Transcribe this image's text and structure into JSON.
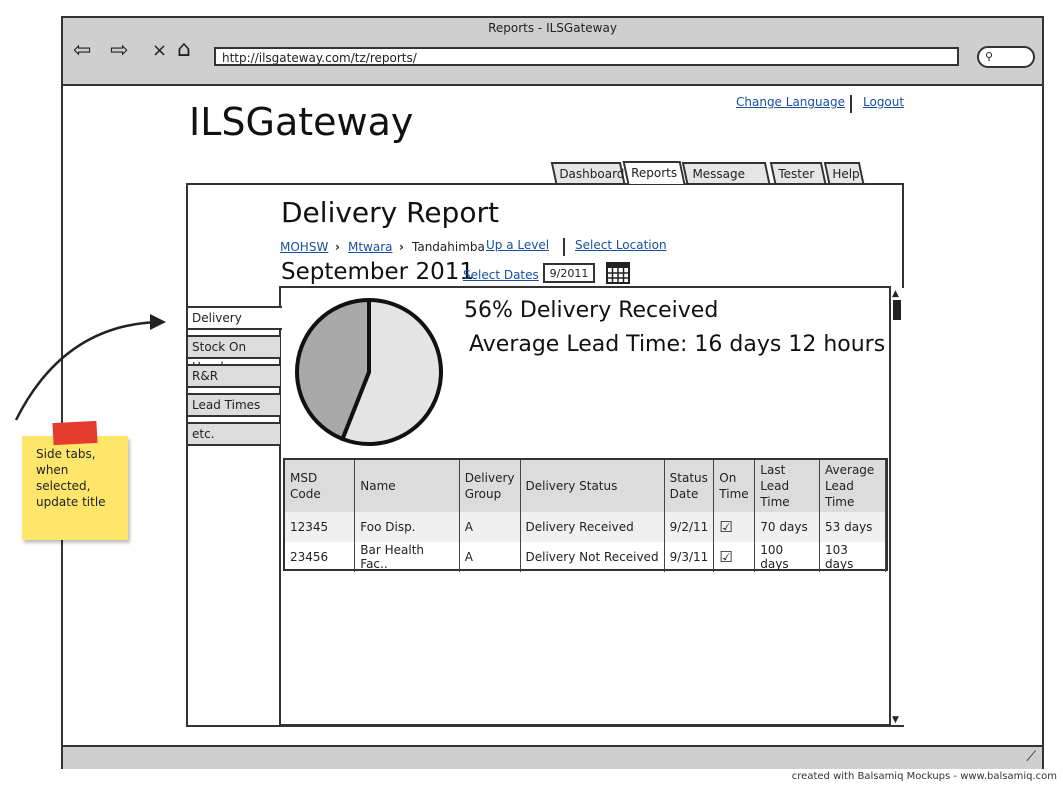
{
  "window": {
    "title": "Reports - ILSGateway",
    "url": "http://ilsgateway.com/tz/reports/"
  },
  "footer": {
    "credit": "created with Balsamiq Mockups - www.balsamiq.com"
  },
  "header": {
    "brand": "ILSGateway",
    "links": [
      "Change Language",
      "Logout"
    ]
  },
  "tabs": [
    {
      "label": "Dashboard",
      "active": false
    },
    {
      "label": "Reports",
      "active": true
    },
    {
      "label": "Message Log",
      "active": false
    },
    {
      "label": "Tester",
      "active": false
    },
    {
      "label": "Help",
      "active": false
    }
  ],
  "report": {
    "title": "Delivery Report",
    "breadcrumb": [
      "MOHSW",
      "Mtwara",
      "Tandahimba"
    ],
    "breadcrumb_separator": "›",
    "up_level": "Up a Level",
    "select_location": "Select Location",
    "month": "September 2011",
    "select_dates": "Select Dates",
    "date": "9/2011",
    "delivery_received": "56% Delivery Received",
    "average_lead_time": "Average Lead Time: 16 days 12 hours"
  },
  "pie": {
    "received_fraction": 0.56,
    "colors": {
      "received": "#e4e4e4",
      "not_received": "#a9a9a9"
    }
  },
  "side_tabs": [
    "Delivery",
    "Stock On Hand",
    "R&R",
    "Lead Times",
    "etc."
  ],
  "table": {
    "headers": [
      "MSD Code",
      "Name",
      "Delivery Group",
      "Delivery Status",
      "Status Date",
      "On Time",
      "Last Lead Time",
      "Average Lead Time"
    ],
    "rows": [
      [
        "12345",
        "Foo Disp.",
        "A",
        "Delivery Received",
        "9/2/11",
        "☑",
        "70 days",
        "53 days"
      ],
      [
        "23456",
        "Bar Health Fac..",
        "A",
        "Delivery Not Received",
        "9/3/11",
        "☑",
        "100 days",
        "103 days"
      ]
    ]
  },
  "note": {
    "text": "Side tabs, when selected, update title"
  },
  "icons": {
    "back": "back-arrow-icon",
    "forward": "forward-arrow-icon",
    "stop": "close-icon",
    "home": "home-icon",
    "search": "search-icon",
    "calendar": "calendar-icon"
  }
}
